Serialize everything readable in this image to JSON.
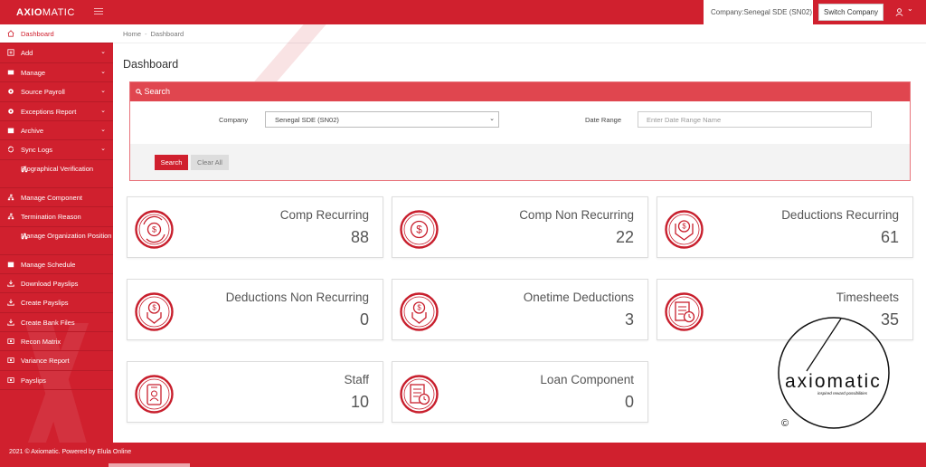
{
  "brand": {
    "logo_bold": "AXIO",
    "logo_thin": "MATIC"
  },
  "header": {
    "company_text": "Company:Senegal SDE (SN02)",
    "switch_label": "Switch Company",
    "user_caret": "⌄"
  },
  "sidebar": {
    "items": [
      {
        "label": "Dashboard",
        "icon": "home-icon"
      },
      {
        "label": "Add",
        "icon": "plus-square-icon",
        "caret": "⌄"
      },
      {
        "label": "Manage",
        "icon": "list-icon",
        "caret": "⌄"
      },
      {
        "label": "Source Payroll",
        "icon": "cog-icon",
        "caret": "⌄"
      },
      {
        "label": "Exceptions Report",
        "icon": "gear-icon",
        "caret": "⌄"
      },
      {
        "label": "Archive",
        "icon": "archive-icon",
        "caret": "⌄"
      },
      {
        "label": "Sync Logs",
        "icon": "sync-icon",
        "caret": "⌄"
      },
      {
        "label": "Biographical Verification",
        "icon": "sitemap-icon"
      },
      {
        "label": "Manage Component",
        "icon": "sitemap-icon"
      },
      {
        "label": "Termination Reason",
        "icon": "sitemap-icon"
      },
      {
        "label": "Manage Organization Position",
        "icon": "sitemap-icon"
      },
      {
        "label": "Manage Schedule",
        "icon": "calendar-icon"
      },
      {
        "label": "Download Payslips",
        "icon": "download-icon"
      },
      {
        "label": "Create Payslips",
        "icon": "download-icon"
      },
      {
        "label": "Create Bank Files",
        "icon": "download-icon"
      },
      {
        "label": "Recon Matrix",
        "icon": "money-icon"
      },
      {
        "label": "Variance Report",
        "icon": "money-icon"
      },
      {
        "label": "Payslips",
        "icon": "money-icon"
      }
    ]
  },
  "breadcrumb": {
    "home": "Home",
    "sep": "-",
    "current": "Dashboard"
  },
  "page": {
    "title": "Dashboard"
  },
  "search": {
    "header": "Search",
    "company_label": "Company",
    "company_value": "Senegal SDE (SN02)",
    "date_label": "Date Range",
    "date_placeholder": "Enter Date Range Name",
    "search_button": "Search",
    "clear_button": "Clear All"
  },
  "cards": [
    {
      "title": "Comp Recurring",
      "value": "88",
      "icon": "recurring-dollar-icon"
    },
    {
      "title": "Comp Non Recurring",
      "value": "22",
      "icon": "dollar-coin-icon"
    },
    {
      "title": "Deductions Recurring",
      "value": "61",
      "icon": "deduction-recurring-icon"
    },
    {
      "title": "Deductions Non Recurring",
      "value": "0",
      "icon": "deduction-icon"
    },
    {
      "title": "Onetime Deductions",
      "value": "3",
      "icon": "deduction-icon"
    },
    {
      "title": "Timesheets",
      "value": "35",
      "icon": "timesheet-icon"
    },
    {
      "title": "Staff",
      "value": "10",
      "icon": "staff-badge-icon"
    },
    {
      "title": "Loan Component",
      "value": "0",
      "icon": "timesheet-icon"
    }
  ],
  "watermark": {
    "name": "axiomatic",
    "tagline": "inspired reward possibilities",
    "copyright": "©"
  },
  "footer": {
    "text": "2021 © Axiomatic. Powered by Elula Online"
  },
  "colors": {
    "brand_red": "#d0202e",
    "panel_header": "#e0464f"
  }
}
